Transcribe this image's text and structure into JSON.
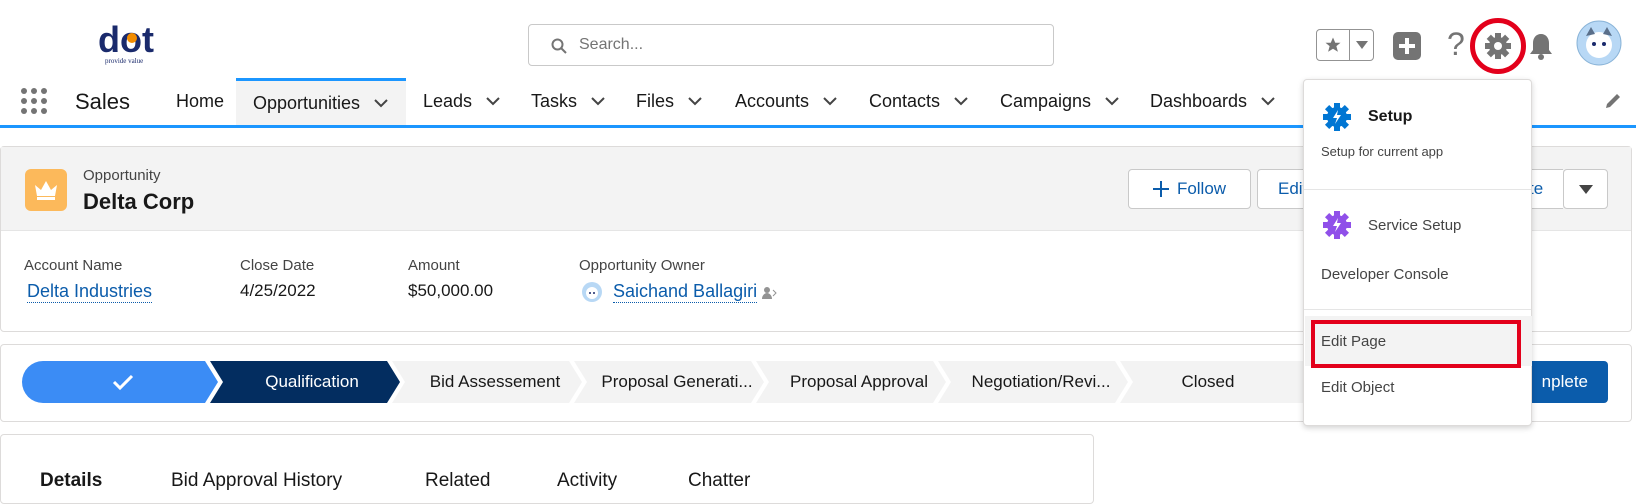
{
  "header": {
    "logo_text": "dot",
    "logo_tagline": "provide value",
    "search_placeholder": "Search..."
  },
  "nav": {
    "app_name": "Sales",
    "items": [
      "Home",
      "Opportunities",
      "Leads",
      "Tasks",
      "Files",
      "Accounts",
      "Contacts",
      "Campaigns",
      "Dashboards"
    ]
  },
  "record": {
    "type_label": "Opportunity",
    "name": "Delta Corp",
    "buttons": {
      "follow": "Follow",
      "edit": "Edit",
      "complete_partial": "te"
    },
    "fields": [
      {
        "label": "Account Name",
        "value": "Delta Industries"
      },
      {
        "label": "Close Date",
        "value": "4/25/2022"
      },
      {
        "label": "Amount",
        "value": "$50,000.00"
      },
      {
        "label": "Opportunity Owner",
        "value": "Saichand Ballagiri"
      }
    ]
  },
  "path": {
    "stages": [
      "Qualification",
      "Bid Assessement",
      "Proposal Generati...",
      "Proposal Approval",
      "Negotiation/Revi...",
      "Closed"
    ],
    "complete_button": "nplete"
  },
  "tabs": [
    "Details",
    "Bid Approval History",
    "Related",
    "Activity",
    "Chatter"
  ],
  "setup_menu": {
    "setup_title": "Setup",
    "setup_sub": "Setup for current app",
    "service_setup": "Service Setup",
    "developer_console": "Developer Console",
    "edit_page": "Edit Page",
    "edit_object": "Edit Object"
  },
  "colors": {
    "brand_blue": "#1b96ff",
    "path_dark": "#032d60",
    "path_done": "#3b8cf5",
    "highlight_red": "#e3001b",
    "link": "#0b5cab"
  }
}
